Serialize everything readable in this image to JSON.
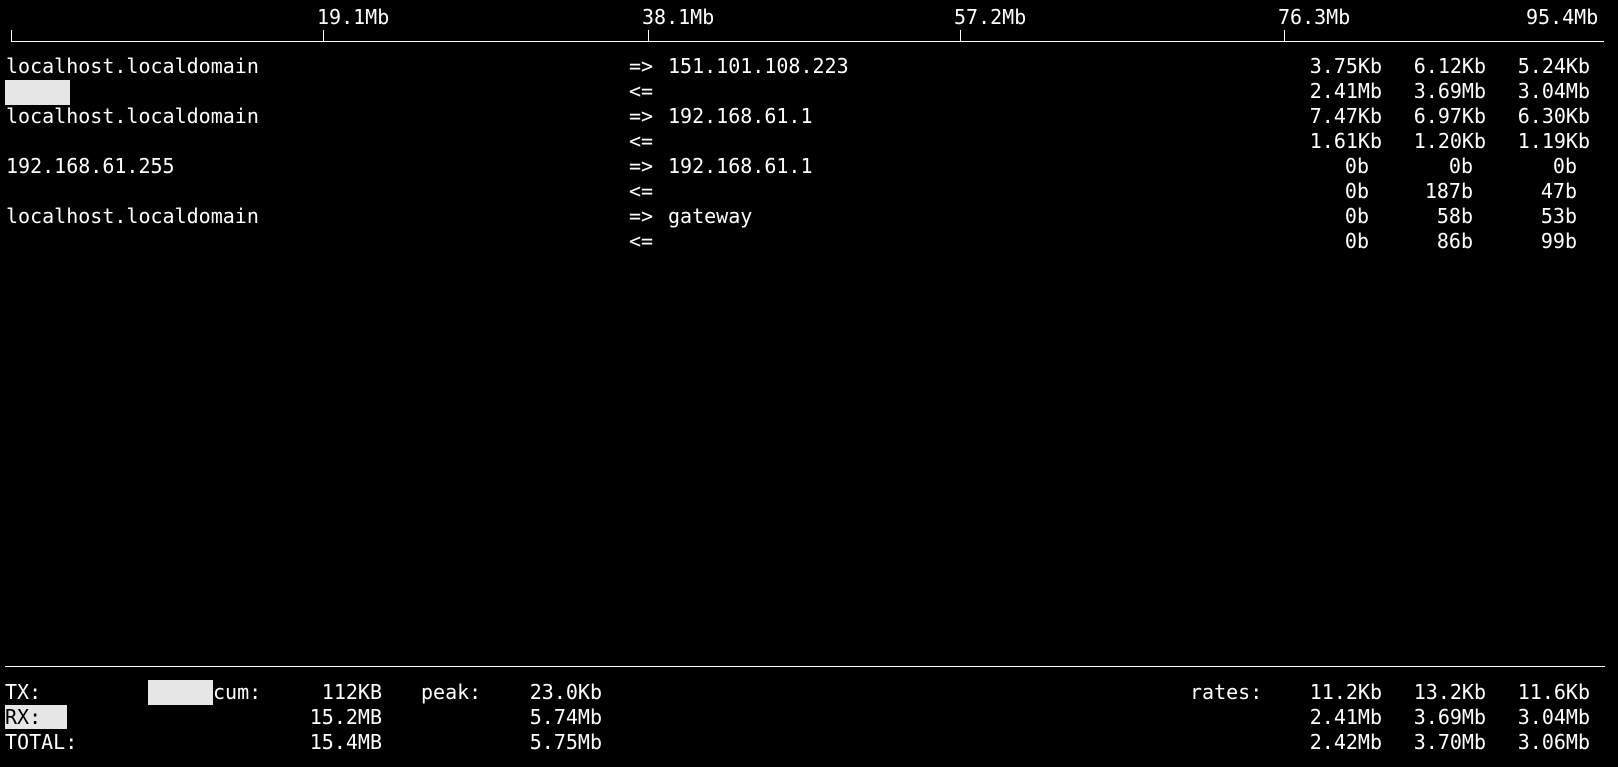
{
  "scale": {
    "ticks": [
      {
        "label": "19.1Mb"
      },
      {
        "label": "38.1Mb"
      },
      {
        "label": "57.2Mb"
      },
      {
        "label": "76.3Mb"
      },
      {
        "label": "95.4Mb"
      }
    ]
  },
  "connections": [
    {
      "host": "localhost.localdomain",
      "out_arrow": "=>",
      "in_arrow": "<=",
      "peer": "151.101.108.223",
      "out_rates": [
        "3.75Kb",
        "6.12Kb",
        "5.24Kb"
      ],
      "in_rates": [
        "2.41Mb",
        "3.69Mb",
        "3.04Mb"
      ]
    },
    {
      "host": "localhost.localdomain",
      "out_arrow": "=>",
      "in_arrow": "<=",
      "peer": "192.168.61.1",
      "out_rates": [
        "7.47Kb",
        "6.97Kb",
        "6.30Kb"
      ],
      "in_rates": [
        "1.61Kb",
        "1.20Kb",
        "1.19Kb"
      ]
    },
    {
      "host": "192.168.61.255",
      "out_arrow": "=>",
      "in_arrow": "<=",
      "peer": "192.168.61.1",
      "out_rates": [
        "0b",
        "0b",
        "0b"
      ],
      "in_rates": [
        "0b",
        "187b",
        "47b"
      ]
    },
    {
      "host": "localhost.localdomain",
      "out_arrow": "=>",
      "in_arrow": "<=",
      "peer": "gateway",
      "out_rates": [
        "0b",
        "58b",
        "53b"
      ],
      "in_rates": [
        "0b",
        "86b",
        "99b"
      ]
    }
  ],
  "totals": {
    "tx_label": "TX:",
    "rx_label": "RX:",
    "total_label": "TOTAL:",
    "cum_label": "cum:",
    "peak_label": "peak:",
    "rates_label": "rates:",
    "tx": {
      "cum": "112KB",
      "peak": "23.0Kb",
      "rates": [
        "11.2Kb",
        "13.2Kb",
        "11.6Kb"
      ]
    },
    "rx": {
      "cum": "15.2MB",
      "peak": "5.74Mb",
      "rates": [
        "2.41Mb",
        "3.69Mb",
        "3.04Mb"
      ]
    },
    "total": {
      "cum": "15.4MB",
      "peak": "5.75Mb",
      "rates": [
        "2.42Mb",
        "3.70Mb",
        "3.06Mb"
      ]
    }
  }
}
